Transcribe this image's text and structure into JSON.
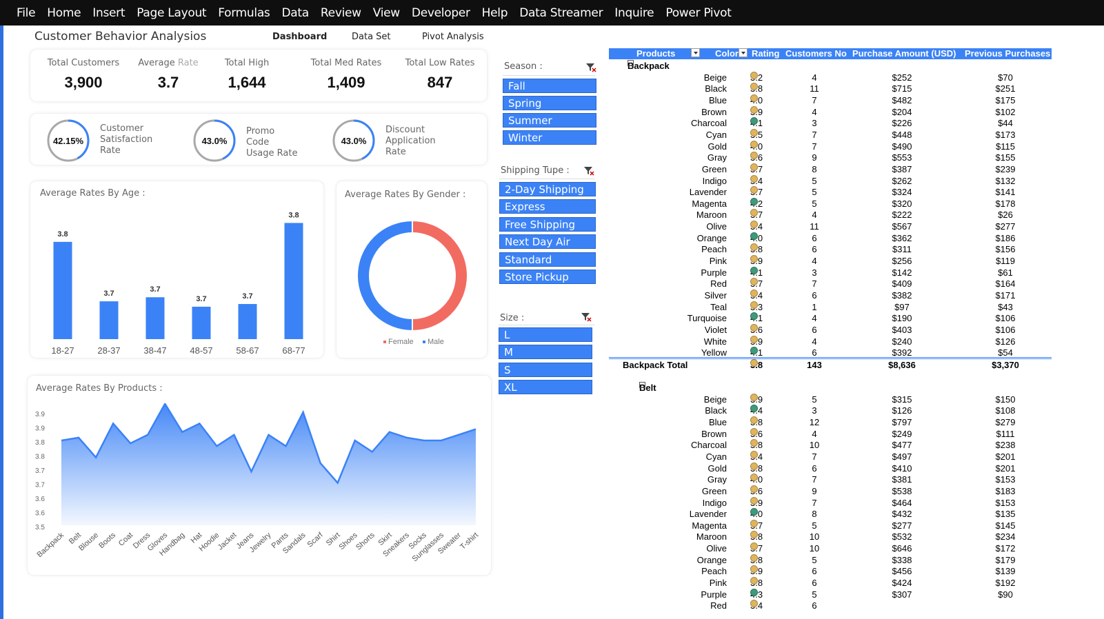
{
  "menu": [
    "File",
    "Home",
    "Insert",
    "Page Layout",
    "Formulas",
    "Data",
    "Review",
    "View",
    "Developer",
    "Help",
    "Data Streamer",
    "Inquire",
    "Power Pivot"
  ],
  "dashboard": {
    "title": "Customer Behavior Analysios",
    "tabs": [
      "Dashboard",
      "Data Set",
      "Pivot Analysis"
    ],
    "kpis": [
      {
        "label": "Total Customers",
        "value": "3,900"
      },
      {
        "label_a": "Average ",
        "label_b": "Rate",
        "value": "3.7"
      },
      {
        "label": "Total High",
        "value": "1,644"
      },
      {
        "label": "Total Med Rates",
        "value": "1,409"
      },
      {
        "label": "Total Low Rates",
        "value": "847"
      }
    ],
    "rings": [
      {
        "value_text": "42.15%",
        "fraction": 0.4215,
        "label": [
          "Customer",
          "Satisfaction",
          "Rate"
        ]
      },
      {
        "value_text": "43.0%",
        "fraction": 0.43,
        "label": [
          "Promo",
          "Code",
          "Usage Rate"
        ]
      },
      {
        "value_text": "43.0%",
        "fraction": 0.43,
        "label": [
          "Discount",
          "Application",
          "Rate"
        ]
      }
    ],
    "accent": "#3b82f6",
    "female_color": "#f26b61"
  },
  "chart_data": [
    {
      "type": "bar",
      "title": "Average Rates By Age :",
      "categories": [
        "18-27",
        "28-37",
        "38-47",
        "48-57",
        "58-67",
        "68-77"
      ],
      "values": [
        3.8,
        3.7,
        3.7,
        3.7,
        3.7,
        3.8
      ],
      "bar_display": [
        0.72,
        0.28,
        0.31,
        0.24,
        0.26,
        0.86
      ],
      "ylim": [
        3.6,
        3.85
      ]
    },
    {
      "type": "pie",
      "title": "Average Rates By Gender :",
      "labels": [
        "Female",
        "Male"
      ],
      "values": [
        50,
        50
      ],
      "colors": [
        "#f26b61",
        "#3b82f6"
      ]
    },
    {
      "type": "area",
      "title": "Average Rates By Products :",
      "yticks": [
        "3.9",
        "3.9",
        "3.8",
        "3.8",
        "3.7",
        "3.7",
        "3.6",
        "3.6",
        "3.5"
      ],
      "ylim": [
        3.5,
        3.9
      ],
      "categories": [
        "Backpack",
        "Belt",
        "Blouse",
        "Boots",
        "Coat",
        "Dress",
        "Gloves",
        "Handbag",
        "Hat",
        "Hoodie",
        "Jacket",
        "Jeans",
        "Jewelry",
        "Pants",
        "Sandals",
        "Scarf",
        "Shirt",
        "Shoes",
        "Shorts",
        "Skirt",
        "Sneakers",
        "Socks",
        "Sunglasses",
        "Sweater",
        "T-shirt"
      ],
      "values": [
        3.8,
        3.81,
        3.74,
        3.86,
        3.79,
        3.82,
        3.93,
        3.83,
        3.86,
        3.78,
        3.82,
        3.69,
        3.82,
        3.78,
        3.9,
        3.72,
        3.65,
        3.8,
        3.76,
        3.83,
        3.81,
        3.8,
        3.8,
        3.82,
        3.84
      ]
    }
  ],
  "slicers": [
    {
      "header": "Season :",
      "items": [
        "Fall",
        "Spring",
        "Summer",
        "Winter"
      ]
    },
    {
      "header": "Shipping Tupe :",
      "items": [
        "2-Day Shipping",
        "Express",
        "Free Shipping",
        "Next Day Air",
        "Standard",
        "Store Pickup"
      ]
    },
    {
      "header": "Size :",
      "items": [
        "L",
        "M",
        "S",
        "XL"
      ]
    }
  ],
  "pivot": {
    "headers": {
      "products": "Products",
      "color": "Color",
      "rating": "Rating",
      "customers": "Customers No",
      "amount": "Purchase Amount (USD)",
      "previous": "Previous Purchases"
    },
    "dot_colors": {
      "tan": "#e0b45e",
      "green": "#3e9a7a"
    },
    "groups": [
      {
        "name": "Backpack",
        "rows": [
          [
            "Beige",
            "3.2",
            "4",
            "$252",
            "$70",
            "tan"
          ],
          [
            "Black",
            "3.8",
            "11",
            "$715",
            "$251",
            "tan"
          ],
          [
            "Blue",
            "4.0",
            "7",
            "$482",
            "$175",
            "tan"
          ],
          [
            "Brown",
            "3.9",
            "4",
            "$204",
            "$102",
            "tan"
          ],
          [
            "Charcoal",
            "4.1",
            "3",
            "$226",
            "$44",
            "green"
          ],
          [
            "Cyan",
            "3.5",
            "7",
            "$448",
            "$173",
            "tan"
          ],
          [
            "Gold",
            "4.0",
            "7",
            "$490",
            "$115",
            "tan"
          ],
          [
            "Gray",
            "3.6",
            "9",
            "$553",
            "$155",
            "tan"
          ],
          [
            "Green",
            "3.7",
            "8",
            "$387",
            "$239",
            "tan"
          ],
          [
            "Indigo",
            "3.4",
            "5",
            "$262",
            "$132",
            "tan"
          ],
          [
            "Lavender",
            "3.7",
            "5",
            "$324",
            "$141",
            "tan"
          ],
          [
            "Magenta",
            "4.2",
            "5",
            "$320",
            "$178",
            "green"
          ],
          [
            "Maroon",
            "3.7",
            "4",
            "$222",
            "$26",
            "tan"
          ],
          [
            "Olive",
            "3.4",
            "11",
            "$567",
            "$277",
            "tan"
          ],
          [
            "Orange",
            "4.0",
            "6",
            "$362",
            "$186",
            "green"
          ],
          [
            "Peach",
            "3.8",
            "6",
            "$311",
            "$156",
            "tan"
          ],
          [
            "Pink",
            "3.9",
            "4",
            "$256",
            "$119",
            "tan"
          ],
          [
            "Purple",
            "4.1",
            "3",
            "$142",
            "$61",
            "green"
          ],
          [
            "Red",
            "3.7",
            "7",
            "$409",
            "$164",
            "tan"
          ],
          [
            "Silver",
            "3.4",
            "6",
            "$382",
            "$171",
            "tan"
          ],
          [
            "Teal",
            "3.3",
            "1",
            "$97",
            "$43",
            "tan"
          ],
          [
            "Turquoise",
            "4.1",
            "4",
            "$190",
            "$106",
            "green"
          ],
          [
            "Violet",
            "3.6",
            "6",
            "$403",
            "$106",
            "tan"
          ],
          [
            "White",
            "3.9",
            "4",
            "$240",
            "$126",
            "tan"
          ],
          [
            "Yellow",
            "4.1",
            "6",
            "$392",
            "$54",
            "green"
          ]
        ],
        "total": {
          "label": "Backpack Total",
          "rating": "3.8",
          "customers": "143",
          "amount": "$8,636",
          "previous": "$3,370"
        }
      },
      {
        "name": "Belt",
        "rows": [
          [
            "Beige",
            "3.9",
            "5",
            "$315",
            "$150",
            "tan"
          ],
          [
            "Black",
            "4.4",
            "3",
            "$126",
            "$108",
            "green"
          ],
          [
            "Blue",
            "3.8",
            "12",
            "$797",
            "$279",
            "tan"
          ],
          [
            "Brown",
            "3.6",
            "4",
            "$249",
            "$111",
            "tan"
          ],
          [
            "Charcoal",
            "3.8",
            "10",
            "$477",
            "$238",
            "tan"
          ],
          [
            "Cyan",
            "3.4",
            "7",
            "$497",
            "$201",
            "tan"
          ],
          [
            "Gold",
            "3.8",
            "6",
            "$410",
            "$201",
            "tan"
          ],
          [
            "Gray",
            "4.0",
            "7",
            "$381",
            "$153",
            "tan"
          ],
          [
            "Green",
            "3.6",
            "9",
            "$538",
            "$183",
            "tan"
          ],
          [
            "Indigo",
            "3.9",
            "7",
            "$464",
            "$153",
            "tan"
          ],
          [
            "Lavender",
            "4.0",
            "8",
            "$432",
            "$135",
            "green"
          ],
          [
            "Magenta",
            "3.7",
            "5",
            "$277",
            "$145",
            "tan"
          ],
          [
            "Maroon",
            "3.8",
            "10",
            "$532",
            "$234",
            "tan"
          ],
          [
            "Olive",
            "3.7",
            "10",
            "$646",
            "$172",
            "tan"
          ],
          [
            "Orange",
            "3.8",
            "5",
            "$338",
            "$179",
            "tan"
          ],
          [
            "Peach",
            "3.9",
            "6",
            "$456",
            "$139",
            "tan"
          ],
          [
            "Pink",
            "3.8",
            "6",
            "$424",
            "$192",
            "tan"
          ],
          [
            "Purple",
            "4.3",
            "5",
            "$307",
            "$90",
            "green"
          ],
          [
            "Red",
            "3.4",
            "6",
            "",
            "",
            "tan"
          ]
        ]
      }
    ]
  }
}
